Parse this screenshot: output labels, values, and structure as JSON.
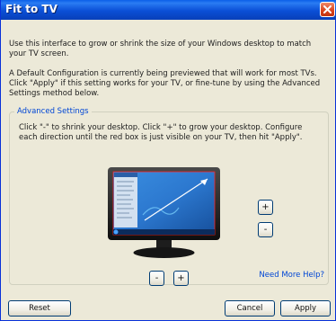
{
  "window": {
    "title": "Fit to TV"
  },
  "intro": {
    "paragraph1": "Use this interface to grow or shrink the size of your Windows desktop to match your TV screen.",
    "paragraph2": "A Default Configuration is currently being previewed that will work for most TVs. Click \"Apply\" if this setting works for your TV, or fine-tune by using the Advanced Settings method below."
  },
  "advanced": {
    "legend": "Advanced Settings",
    "instructions": "Click \"-\" to shrink  your desktop. Click \"+\" to grow your desktop. Configure each direction until the red box is just visible on your TV, then hit \"Apply\".",
    "vertical_plus": "+",
    "vertical_minus": "-",
    "horizontal_minus": "-",
    "horizontal_plus": "+",
    "help_link": "Need More Help?"
  },
  "buttons": {
    "reset": "Reset",
    "cancel": "Cancel",
    "apply": "Apply"
  },
  "colors": {
    "title_bar": "#0a4fd6",
    "window_bg": "#ece9d8",
    "link": "#0046d5",
    "close_button": "#d9411a"
  }
}
